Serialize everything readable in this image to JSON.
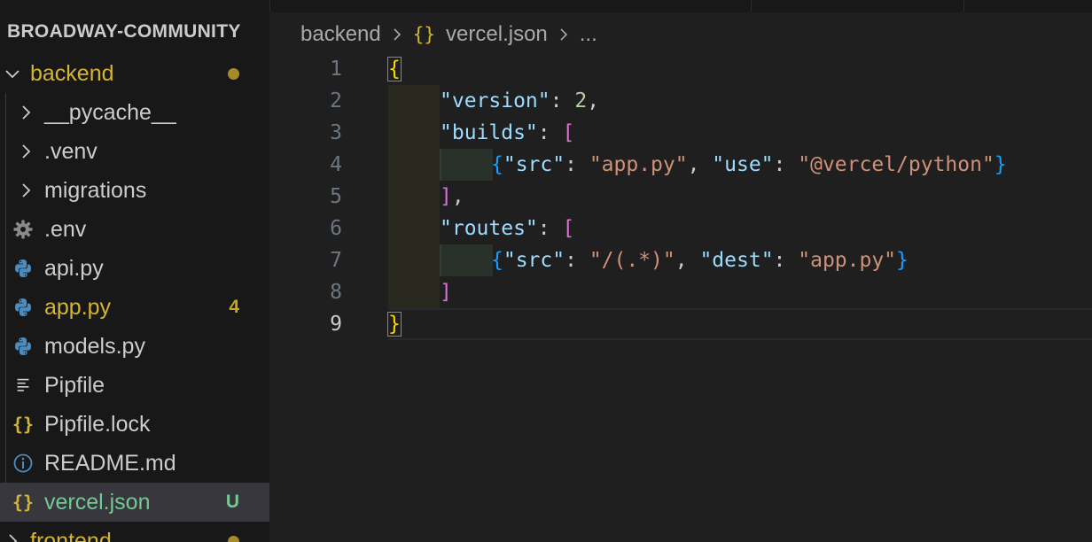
{
  "explorer": {
    "title": "BROADWAY-COMMUNITY",
    "items": [
      {
        "label": "backend",
        "type": "folder-open",
        "decoration": "dot",
        "color": "#d3b535"
      },
      {
        "label": "__pycache__",
        "type": "folder-closed"
      },
      {
        "label": ".venv",
        "type": "folder-closed"
      },
      {
        "label": "migrations",
        "type": "folder-closed"
      },
      {
        "label": ".env",
        "type": "file",
        "icon": "gear-icon"
      },
      {
        "label": "api.py",
        "type": "file",
        "icon": "python-icon"
      },
      {
        "label": "app.py",
        "type": "file",
        "icon": "python-icon",
        "badge": "4",
        "color": "#d3b535"
      },
      {
        "label": "models.py",
        "type": "file",
        "icon": "python-icon"
      },
      {
        "label": "Pipfile",
        "type": "file",
        "icon": "lines-icon"
      },
      {
        "label": "Pipfile.lock",
        "type": "file",
        "icon": "json-braces-icon"
      },
      {
        "label": "README.md",
        "type": "file",
        "icon": "info-icon"
      },
      {
        "label": "vercel.json",
        "type": "file",
        "icon": "json-braces-icon",
        "badge": "U",
        "selected": true,
        "color": "#73c991"
      },
      {
        "label": "frontend",
        "type": "folder-closed",
        "decoration": "dot",
        "color": "#d3b535"
      }
    ]
  },
  "breadcrumb": {
    "folder": "backend",
    "file_icon": "{}",
    "file": "vercel.json",
    "more": "..."
  },
  "editor": {
    "active_line": 9,
    "lines": [
      {
        "n": "1"
      },
      {
        "n": "2"
      },
      {
        "n": "3"
      },
      {
        "n": "4"
      },
      {
        "n": "5"
      },
      {
        "n": "6"
      },
      {
        "n": "7"
      },
      {
        "n": "8"
      },
      {
        "n": "9"
      }
    ],
    "tokens": {
      "open_brace": "{",
      "close_brace": "}",
      "k_version": "\"version\"",
      "v_version": "2",
      "k_builds": "\"builds\"",
      "k_src": "\"src\"",
      "v_src_build": "\"app.py\"",
      "k_use": "\"use\"",
      "v_use": "\"@vercel/python\"",
      "k_routes": "\"routes\"",
      "v_src_route": "\"/(.*)\"",
      "k_dest": "\"dest\"",
      "v_dest": "\"app.py\"",
      "colon": ": ",
      "comma": ",",
      "comma_sp": ", ",
      "open_bracket": "[",
      "close_bracket": "]"
    }
  },
  "colors": {
    "git_untracked": "#73c991",
    "git_modified": "#d3b535",
    "warning_badge": "#c9a524"
  }
}
